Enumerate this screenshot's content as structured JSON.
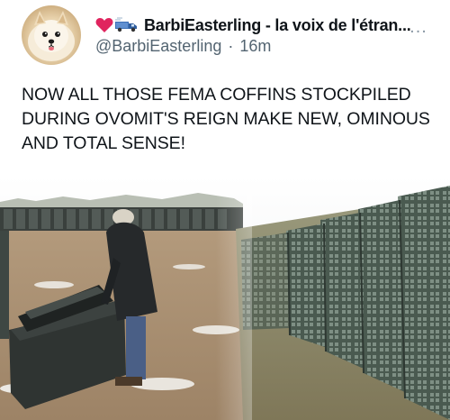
{
  "tweet": {
    "author": {
      "display_name": "BarbiEasterling - la voix de l'étran...",
      "handle": "@BarbiEasterling",
      "time": "16m",
      "name_emojis": [
        "heart-icon",
        "truck-icon"
      ]
    },
    "text": "NOW ALL THOSE FEMA COFFINS STOCKPILED\nDURING OVOMIT'S REIGN MAKE NEW, OMINOUS\nAND TOTAL SENSE!",
    "more_label": "...",
    "separator": "·"
  },
  "colors": {
    "text": "#0f1419",
    "secondary": "#536471",
    "heart": "#e0245e"
  }
}
